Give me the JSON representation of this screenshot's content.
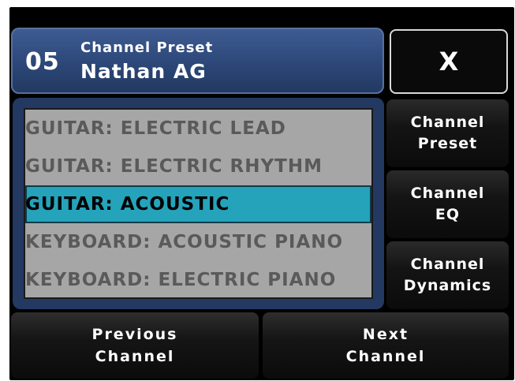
{
  "header": {
    "channel_number": "05",
    "subtitle": "Channel Preset",
    "channel_name": "Nathan AG"
  },
  "close_label": "X",
  "preset_list": [
    {
      "label": "GUITAR: ELECTRIC LEAD",
      "selected": false
    },
    {
      "label": "GUITAR: ELECTRIC RHYTHM",
      "selected": false
    },
    {
      "label": "GUITAR: ACOUSTIC",
      "selected": true
    },
    {
      "label": "KEYBOARD: ACOUSTIC PIANO",
      "selected": false
    },
    {
      "label": "KEYBOARD: ELECTRIC PIANO",
      "selected": false
    }
  ],
  "side_buttons": {
    "preset": {
      "line1": "Channel",
      "line2": "Preset"
    },
    "eq": {
      "line1": "Channel",
      "line2": "EQ"
    },
    "dynamics": {
      "line1": "Channel",
      "line2": "Dynamics"
    }
  },
  "bottom_buttons": {
    "previous": {
      "line1": "Previous",
      "line2": "Channel"
    },
    "next": {
      "line1": "Next",
      "line2": "Channel"
    }
  },
  "colors": {
    "header_blue": "#2c4778",
    "selection_cyan": "#25a3bb",
    "list_gray": "#a6a6a6"
  }
}
